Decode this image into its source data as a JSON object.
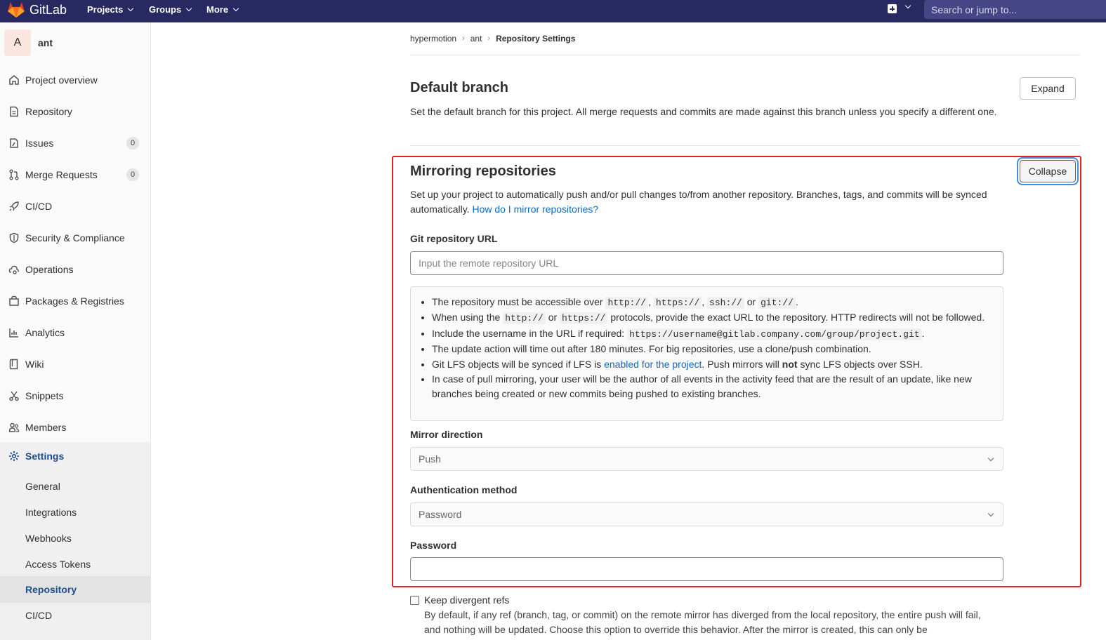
{
  "header": {
    "brand": "GitLab",
    "nav": [
      "Projects",
      "Groups",
      "More"
    ],
    "search_placeholder": "Search or jump to..."
  },
  "sidebar": {
    "avatar_letter": "A",
    "project_name": "ant",
    "items": [
      {
        "label": "Project overview",
        "icon": "home-icon"
      },
      {
        "label": "Repository",
        "icon": "document-icon"
      },
      {
        "label": "Issues",
        "icon": "issues-icon",
        "badge": "0"
      },
      {
        "label": "Merge Requests",
        "icon": "merge-request-icon",
        "badge": "0"
      },
      {
        "label": "CI/CD",
        "icon": "rocket-icon"
      },
      {
        "label": "Security & Compliance",
        "icon": "shield-icon"
      },
      {
        "label": "Operations",
        "icon": "cloud-gear-icon"
      },
      {
        "label": "Packages & Registries",
        "icon": "package-icon"
      },
      {
        "label": "Analytics",
        "icon": "chart-icon"
      },
      {
        "label": "Wiki",
        "icon": "book-icon"
      },
      {
        "label": "Snippets",
        "icon": "scissors-icon"
      },
      {
        "label": "Members",
        "icon": "users-icon"
      },
      {
        "label": "Settings",
        "icon": "gear-icon"
      }
    ],
    "settings_sub": [
      "General",
      "Integrations",
      "Webhooks",
      "Access Tokens",
      "Repository",
      "CI/CD"
    ]
  },
  "breadcrumb": [
    "hypermotion",
    "ant",
    "Repository Settings"
  ],
  "default_branch": {
    "title": "Default branch",
    "description": "Set the default branch for this project. All merge requests and commits are made against this branch unless you specify a different one.",
    "button": "Expand"
  },
  "mirroring": {
    "title": "Mirroring repositories",
    "description": "Set up your project to automatically push and/or pull changes to/from another repository. Branches, tags, and commits will be synced automatically.",
    "help_link": "How do I mirror repositories?",
    "button": "Collapse",
    "url_label": "Git repository URL",
    "url_placeholder": "Input the remote repository URL",
    "info": {
      "b1_pre": "The repository must be accessible over",
      "b1_c1": "http://",
      "b1_c2": "https://",
      "b1_c3": "ssh://",
      "b1_or": "or",
      "b1_c4": "git://",
      "b2_pre": "When using the",
      "b2_c1": "http://",
      "b2_or": "or",
      "b2_c2": "https://",
      "b2_post": "protocols, provide the exact URL to the repository. HTTP redirects will not be followed.",
      "b3_pre": "Include the username in the URL if required:",
      "b3_code": "https://username@gitlab.company.com/group/project.git",
      "b4": "The update action will time out after 180 minutes. For big repositories, use a clone/push combination.",
      "b5_pre": "Git LFS objects will be synced if LFS is",
      "b5_link": "enabled for the project",
      "b5_mid": ". Push mirrors will",
      "b5_bold": "not",
      "b5_post": "sync LFS objects over SSH.",
      "b6": "In case of pull mirroring, your user will be the author of all events in the activity feed that are the result of an update, like new branches being created or new commits being pushed to existing branches."
    },
    "direction_label": "Mirror direction",
    "direction_value": "Push",
    "auth_label": "Authentication method",
    "auth_value": "Password",
    "password_label": "Password",
    "password_value": ""
  },
  "divergent": {
    "label": "Keep divergent refs",
    "help": "By default, if any ref (branch, tag, or commit) on the remote mirror has diverged from the local repository, the entire push will fail, and nothing will be updated. Choose this option to override this behavior. After the mirror is created, this can only be"
  },
  "colors": {
    "header_bg": "#292961",
    "link": "#1068bf",
    "highlight": "#e52222"
  }
}
